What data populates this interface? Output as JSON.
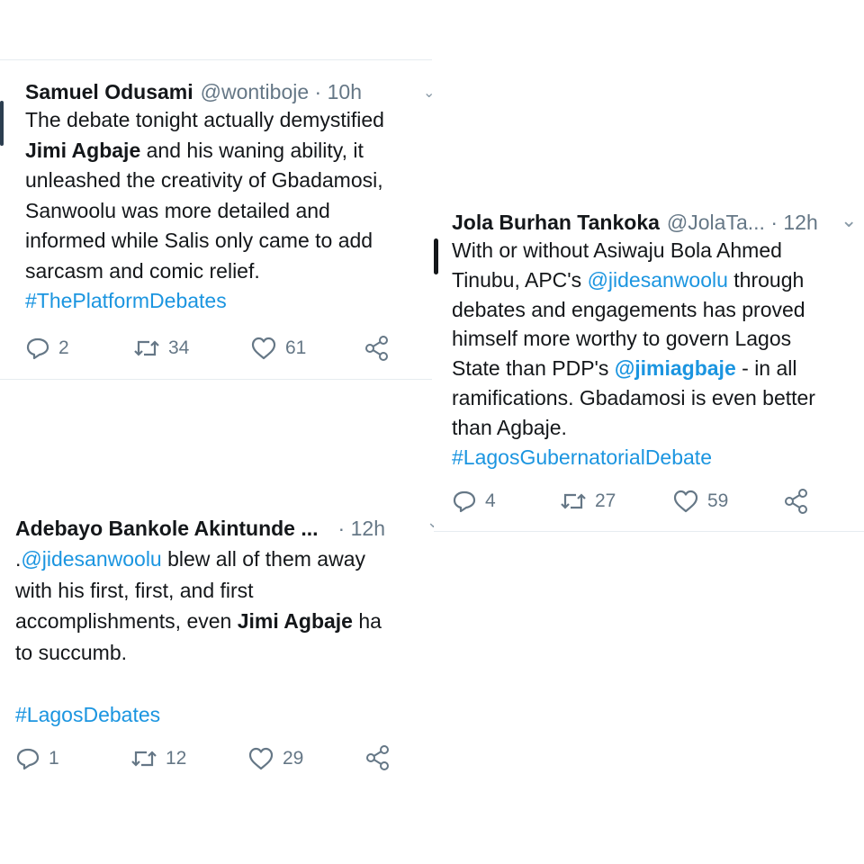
{
  "tweets": [
    {
      "author": "Samuel Odusami",
      "handle": "@wontiboje",
      "time": "10h",
      "lines": [
        "The debate tonight actually demystified",
        "and his waning ability, it",
        "unleashed the creativity of Gbadamosi,",
        "Sanwoolu was more detailed and",
        "informed while Salis only came to add",
        "sarcasm and comic relief."
      ],
      "bold_name": "Jimi Agbaje",
      "hashtag": "#ThePlatformDebates",
      "replies": "2",
      "retweets": "34",
      "likes": "61"
    },
    {
      "author": "Jola Burhan Tankoka",
      "handle": "@JolaTa...",
      "time": "12h",
      "lines": [
        "With or without Asiwaju Bola Ahmed",
        "Tinubu, APC's",
        "through",
        "debates and engagements has proved",
        "himself more worthy to govern Lagos",
        "State than PDP's",
        "- in all",
        "ramifications. Gbadamosi is even better",
        "than Agbaje."
      ],
      "mention_1": "@jidesanwoolu",
      "mention_2": "@jimiagbaje",
      "hashtag": "#LagosGubernatorialDebate",
      "replies": "4",
      "retweets": "27",
      "likes": "59"
    },
    {
      "author": "Adebayo Bankole Akintunde ...",
      "time": "12h",
      "prefix": ".",
      "mention": "@jidesanwoolu",
      "lines": [
        "blew all of them away",
        "with his first, first, and first",
        "accomplishments, even",
        "ha",
        "to succumb."
      ],
      "bold_name": "Jimi Agbaje",
      "hashtag": "#LagosDebates",
      "replies": "1",
      "retweets": "12",
      "likes": "29"
    }
  ],
  "icons": {
    "reply": "reply-icon",
    "retweet": "retweet-icon",
    "like": "like-icon",
    "share": "share-icon",
    "caret": "chevron-down-icon"
  },
  "colors": {
    "link": "#1b95e0",
    "muted": "#657786",
    "divider": "#e6ecf0"
  }
}
